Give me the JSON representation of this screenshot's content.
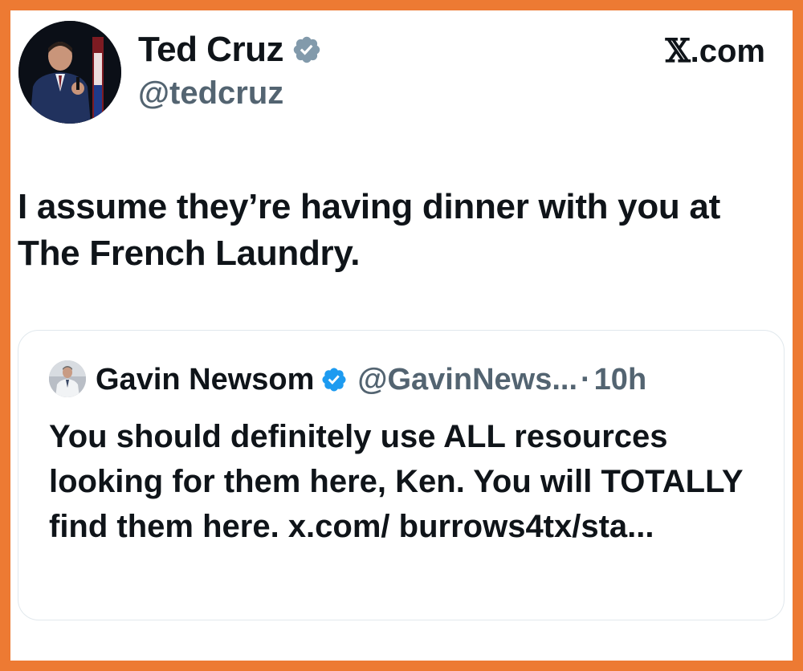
{
  "author": {
    "name": "Ted Cruz",
    "handle": "@tedcruz",
    "avatar_icon": "profile-photo",
    "verified_icon": "verified-badge-gray"
  },
  "site": {
    "label": ".com",
    "logo_icon": "x-logo"
  },
  "tweet": {
    "text": "I assume they’re having dinner with you at The French Laundry."
  },
  "quoted_tweet": {
    "name": "Gavin Newsom",
    "handle": "@GavinNews...",
    "separator": "·",
    "time": "10h",
    "text": "You should definitely use ALL resources looking for them here, Ken. You will TOTALLY find them here. x.com/ burrows4tx/sta...",
    "avatar_icon": "profile-photo",
    "verified_icon": "verified-badge-blue"
  },
  "colors": {
    "frame_border": "#ED7A33",
    "text_primary": "#0f1419",
    "text_secondary": "#536471",
    "verified_blue": "#1D9BF0",
    "verified_gray": "#829AAB"
  }
}
